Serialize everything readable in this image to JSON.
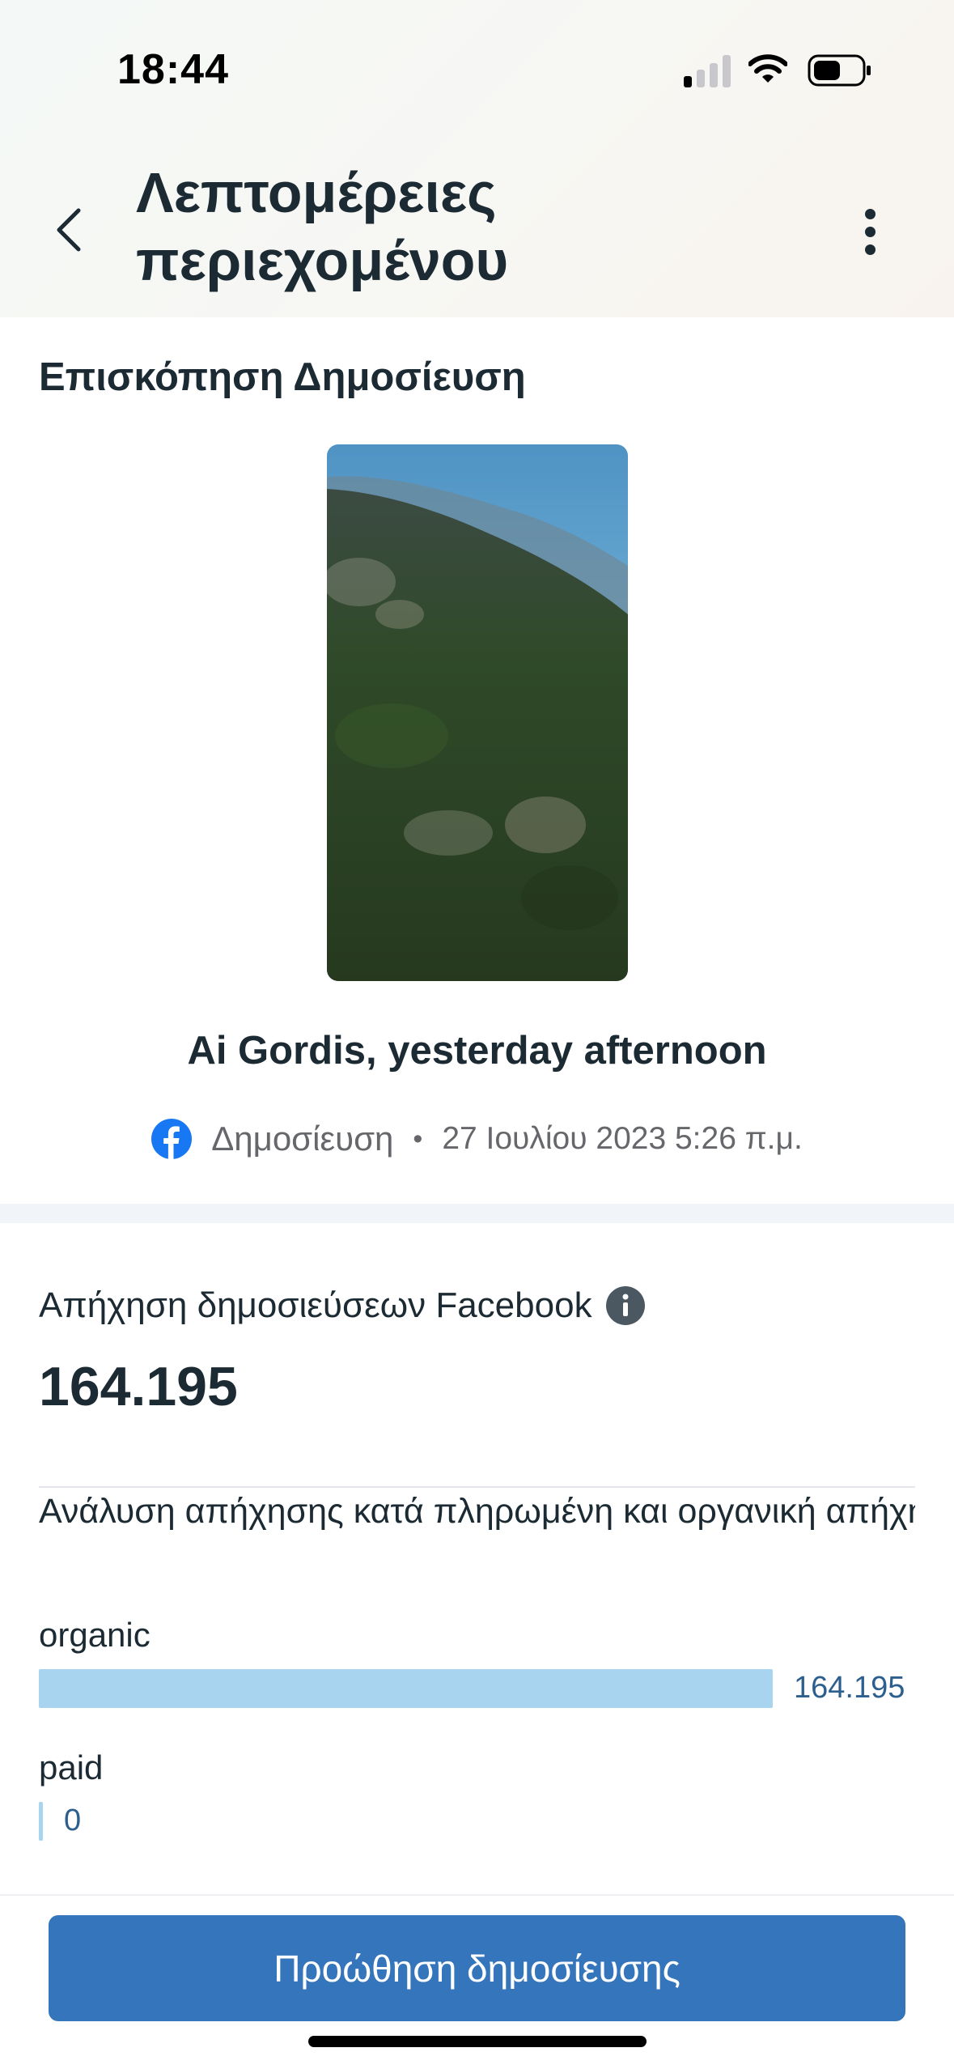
{
  "status_bar": {
    "time": "18:44"
  },
  "header": {
    "title": "Λεπτομέρειες περιεχομένου",
    "back_icon": "chevron-left-icon",
    "more_icon": "more-vertical-icon"
  },
  "preview": {
    "heading": "Επισκόπηση Δημοσίευση",
    "post_title": "Ai Gordis, yesterday afternoon",
    "platform_icon": "facebook-icon",
    "post_type": "Δημοσίευση",
    "separator": "•",
    "date": "27 Ιουλίου 2023 5:26 π.μ."
  },
  "reach": {
    "label": "Απήχηση δημοσιεύσεων Facebook",
    "info_icon": "info-icon",
    "value": "164.195"
  },
  "breakdown": {
    "label": "Ανάλυση απήχησης κατά πληρωμένη και οργανική απήχηση",
    "max": 164195,
    "items": [
      {
        "label": "organic",
        "value": 164195,
        "value_text": "164.195"
      },
      {
        "label": "paid",
        "value": 0,
        "value_text": "0"
      }
    ]
  },
  "footer": {
    "promote_label": "Προώθηση δημοσίευσης"
  },
  "colors": {
    "bar_fill": "#a8d4ef",
    "bar_value_text": "#2d5f8e",
    "button_bg": "#3575bb",
    "facebook_blue": "#1877f2",
    "text_primary": "#1c2b33"
  }
}
